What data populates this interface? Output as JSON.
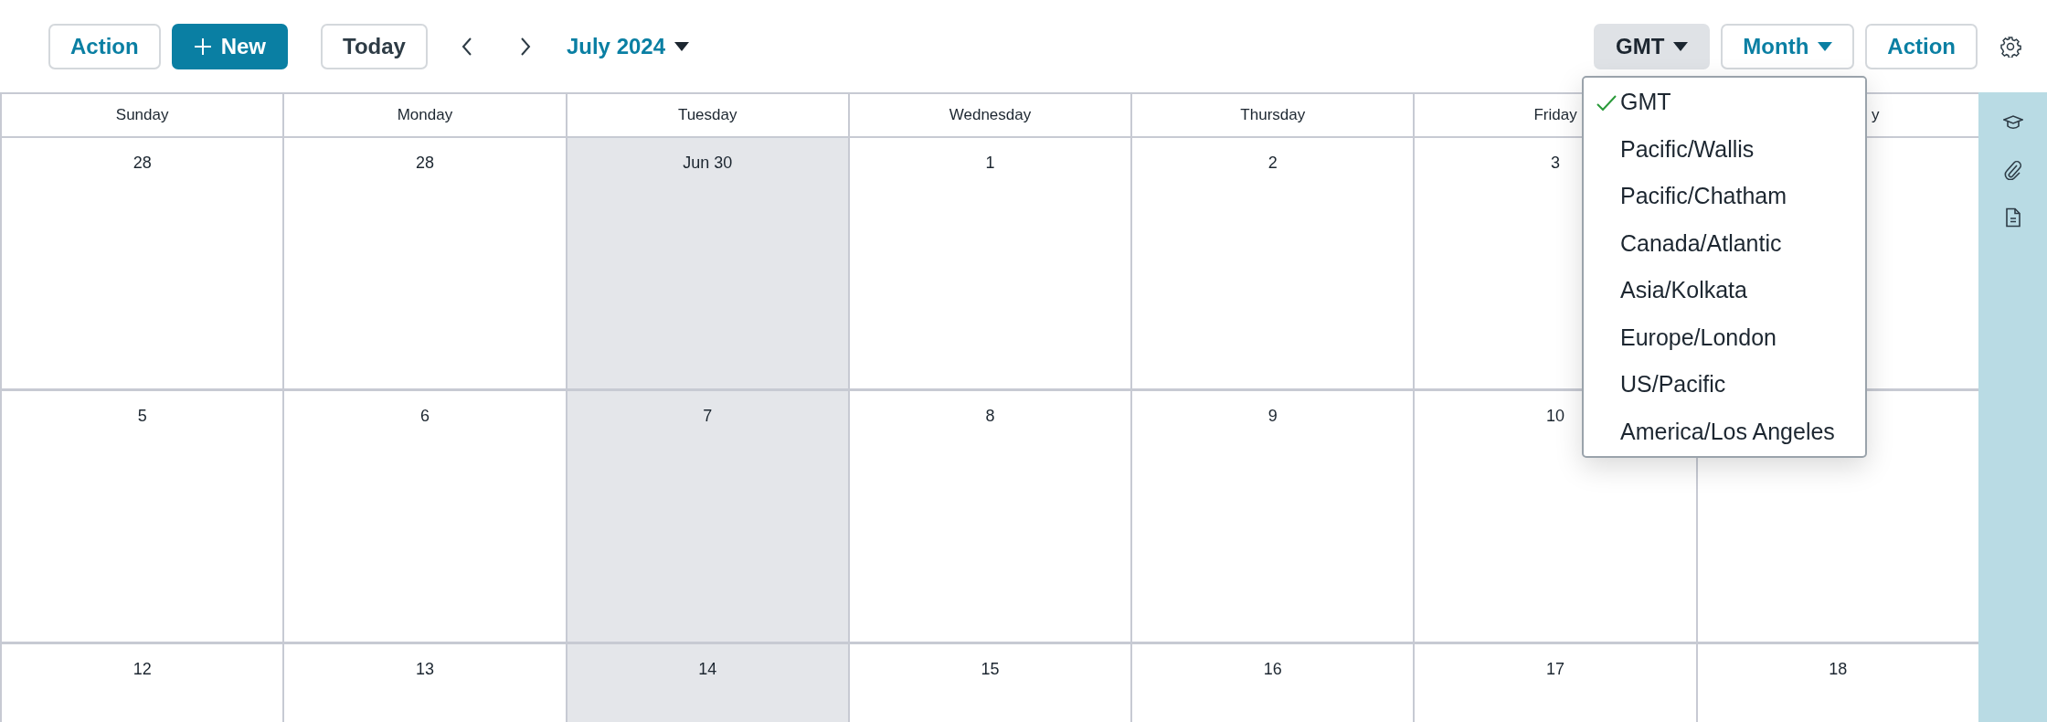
{
  "toolbar": {
    "left_buttons": [
      {
        "label": "Action",
        "kind": "outline"
      },
      {
        "label": "New",
        "kind": "primary"
      },
      {
        "label": "Today",
        "kind": "plain"
      }
    ],
    "period": "July 2024",
    "right_buttons": [
      {
        "label": "GMT",
        "kind": "active"
      },
      {
        "label": "Month",
        "kind": "dropdown"
      },
      {
        "label": "Action",
        "kind": "outline"
      }
    ]
  },
  "timezone_menu": [
    {
      "label": "GMT",
      "selected": true
    },
    {
      "label": "Pacific/Wallis",
      "selected": false
    },
    {
      "label": "Pacific/Chatham",
      "selected": false
    },
    {
      "label": "Canada/Atlantic",
      "selected": false
    },
    {
      "label": "Asia/Kolkata",
      "selected": false
    },
    {
      "label": "Europe/London",
      "selected": false
    },
    {
      "label": "US/Pacific",
      "selected": false
    },
    {
      "label": "America/Los Angeles",
      "selected": false
    }
  ],
  "calendar": {
    "columns": [
      {
        "label": "Sunday",
        "shaded": false
      },
      {
        "label": "Monday",
        "shaded": false
      },
      {
        "label": "Tuesday",
        "shaded": true
      },
      {
        "label": "Wednesday",
        "shaded": false
      },
      {
        "label": "Thursday",
        "shaded": false
      },
      {
        "label": "Friday",
        "shaded": false
      },
      {
        "label": "y",
        "shaded": false
      }
    ],
    "weeks": [
      [
        "28",
        "28",
        "Jun 30",
        "1",
        "2",
        "3"
      ],
      [
        "5",
        "6",
        "7",
        "8",
        "9",
        "10"
      ],
      [
        "12",
        "13",
        "14",
        "15",
        "16",
        "17",
        "18"
      ]
    ]
  }
}
